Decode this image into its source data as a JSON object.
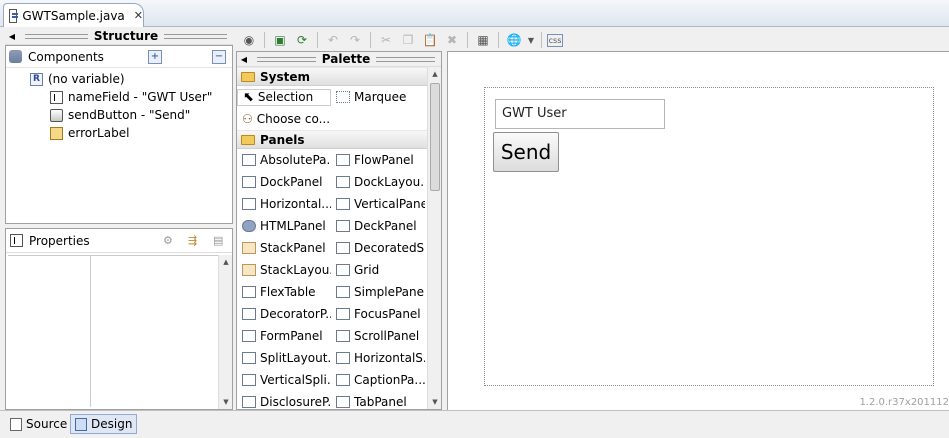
{
  "editor_tab": {
    "title": "GWTSample.java"
  },
  "structure": {
    "header": "Structure",
    "components_title": "Components",
    "tree": [
      {
        "label": "(no variable)",
        "icon": "root-panel-icon"
      },
      {
        "label": "nameField - \"GWT User\"",
        "icon": "textbox-icon"
      },
      {
        "label": "sendButton - \"Send\"",
        "icon": "button-icon"
      },
      {
        "label": "errorLabel",
        "icon": "label-icon"
      }
    ],
    "root_badge": "R"
  },
  "properties": {
    "title": "Properties"
  },
  "palette": {
    "header": "Palette",
    "system": {
      "label": "System",
      "selection": "Selection",
      "marquee": "Marquee",
      "choose": "Choose co..."
    },
    "panels": {
      "label": "Panels",
      "rows": [
        [
          "AbsolutePa...",
          "FlowPanel"
        ],
        [
          "DockPanel",
          "DockLayou..."
        ],
        [
          "Horizontal...",
          "VerticalPanel"
        ],
        [
          "HTMLPanel",
          "DeckPanel"
        ],
        [
          "StackPanel",
          "DecoratedS..."
        ],
        [
          "StackLayou...",
          "Grid"
        ],
        [
          "FlexTable",
          "SimplePanel"
        ],
        [
          "DecoratorP...",
          "FocusPanel"
        ],
        [
          "FormPanel",
          "ScrollPanel"
        ],
        [
          "SplitLayout...",
          "HorizontalS..."
        ],
        [
          "VerticalSpli...",
          "CaptionPa..."
        ],
        [
          "DisclosureP...",
          "TabPanel"
        ]
      ]
    }
  },
  "toolbar": {
    "css_label": "css"
  },
  "canvas": {
    "textbox_value": "GWT User",
    "button_label": "Send",
    "version": "1.2.0.r37x201112"
  },
  "bottom_tabs": {
    "source": "Source",
    "design": "Design"
  },
  "colors": {
    "selection_blue": "#dfe7f5",
    "folder": "#f3c95a"
  }
}
